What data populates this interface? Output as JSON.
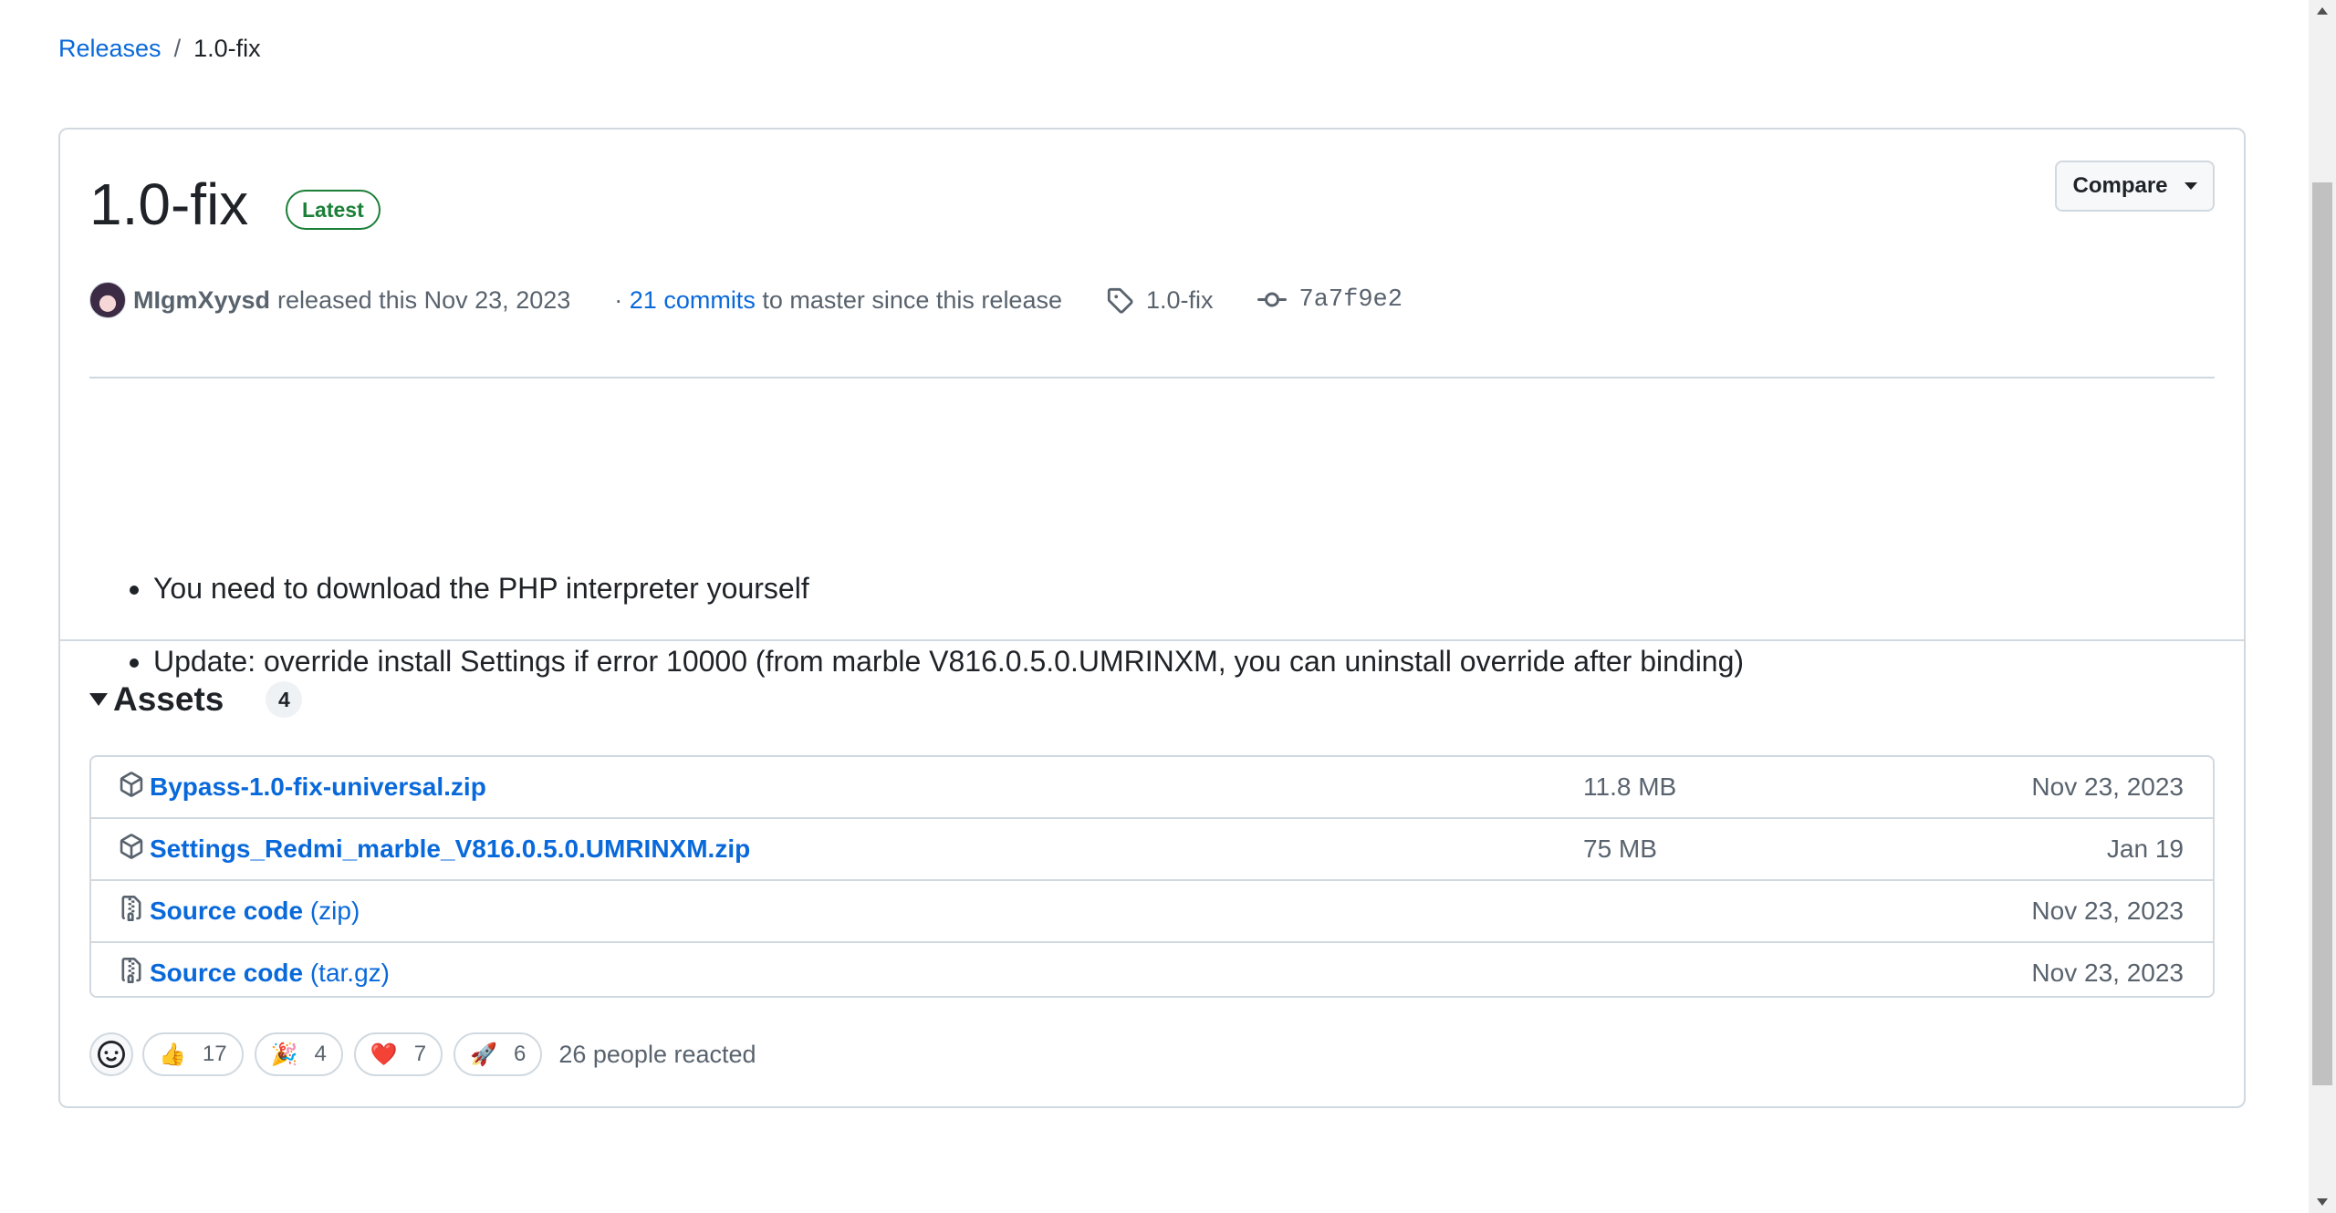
{
  "breadcrumb": {
    "parent": "Releases",
    "separator": "/",
    "current": "1.0-fix"
  },
  "release": {
    "title": "1.0-fix",
    "badge": "Latest",
    "compare_label": "Compare",
    "author": "MIgmXyysd",
    "released_text": "released this Nov 23, 2023",
    "commits_prefix": "·",
    "commits_link": "21 commits",
    "commits_suffix": "to master since this release",
    "tag": "1.0-fix",
    "commit_sha": "7a7f9e2",
    "notes": [
      "You need to download the PHP interpreter yourself",
      "Update: override install Settings if error 10000 (from marble V816.0.5.0.UMRINXM, you can uninstall override after binding)"
    ]
  },
  "assets": {
    "title": "Assets",
    "count": "4",
    "rows": [
      {
        "name": "Bypass-1.0-fix-universal.zip",
        "sub": "",
        "size": "11.8 MB",
        "date": "Nov 23, 2023",
        "icon": "package-icon"
      },
      {
        "name": "Settings_Redmi_marble_V816.0.5.0.UMRINXM.zip",
        "sub": "",
        "size": "75 MB",
        "date": "Jan 19",
        "icon": "package-icon"
      },
      {
        "name": "Source code",
        "sub": "(zip)",
        "size": "",
        "date": "Nov 23, 2023",
        "icon": "file-zip-icon"
      },
      {
        "name": "Source code",
        "sub": "(tar.gz)",
        "size": "",
        "date": "Nov 23, 2023",
        "icon": "file-zip-icon"
      }
    ]
  },
  "reactions": {
    "items": [
      {
        "emoji": "👍",
        "count": "17"
      },
      {
        "emoji": "🎉",
        "count": "4"
      },
      {
        "emoji": "❤️",
        "count": "7"
      },
      {
        "emoji": "🚀",
        "count": "6"
      }
    ],
    "summary": "26 people reacted"
  },
  "colors": {
    "link": "#0969da",
    "latest": "#1a7f37",
    "border": "#d1d9e0",
    "muted": "#59636e"
  }
}
